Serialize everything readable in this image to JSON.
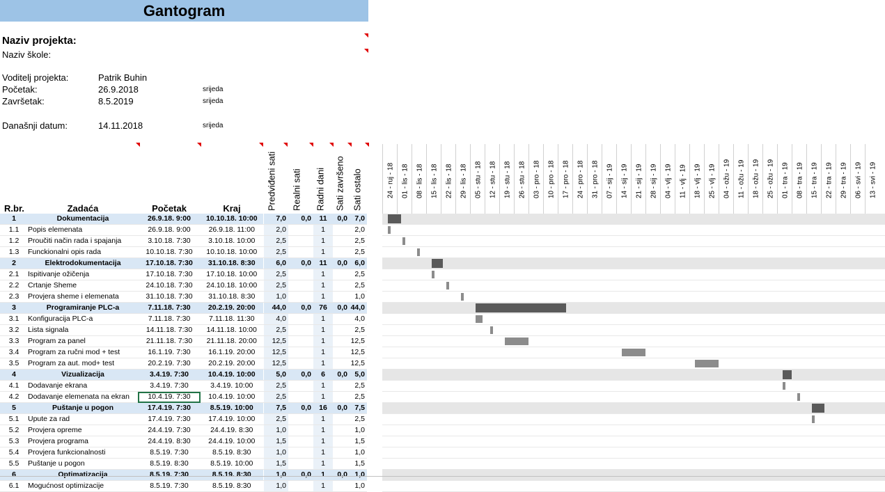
{
  "title": "Gantogram",
  "project": {
    "name_label": "Naziv projekta:",
    "school_label": "Naziv škole:",
    "leader_label": "Voditelj projekta:",
    "leader": "Patrik Buhin",
    "start_label": "Početak:",
    "start_date": "26.9.2018",
    "start_day": "srijeda",
    "end_label": "Završetak:",
    "end_date": "8.5.2019",
    "end_day": "srijeda",
    "today_label": "Današnji datum:",
    "today_date": "14.11.2018",
    "today_day": "srijeda"
  },
  "columns": {
    "id": "R.br.",
    "task": "Zadaća",
    "start": "Početak",
    "end": "Kraj",
    "planned_hours": "Predviđeni sati",
    "real_hours": "Realni sati",
    "work_days": "Radni dani",
    "hours_done": "Sati završeno",
    "hours_left": "Sati ostalo"
  },
  "timeline_weeks": [
    "24 - ruj - 18",
    "01 - lis - 18",
    "08 - lis - 18",
    "15 - lis - 18",
    "22 - lis - 18",
    "29 - lis - 18",
    "05 - stu - 18",
    "12 - stu - 18",
    "19 - stu - 18",
    "26 - stu - 18",
    "03 - pro - 18",
    "10 - pro - 18",
    "17 - pro - 18",
    "24 - pro - 18",
    "31 - pro - 18",
    "07 - sij - 19",
    "14 - sij - 19",
    "21 - sij - 19",
    "28 - sij - 19",
    "04 - vlj - 19",
    "11 - vlj - 19",
    "18 - vlj - 19",
    "25 - vlj - 19",
    "04 - ožu - 19",
    "11 - ožu - 19",
    "18 - ožu - 19",
    "25 - ožu - 19",
    "01 - tra - 19",
    "08 - tra - 19",
    "15 - tra - 19",
    "22 - tra - 19",
    "29 - tra - 19",
    "06 - svi - 19",
    "13 - svi - 19"
  ],
  "rows": [
    {
      "phase": true,
      "id": "1",
      "task": "Dokumentacija",
      "start": "26.9.18. 9:00",
      "end": "10.10.18. 10:00",
      "pred": "7,0",
      "real": "0,0",
      "days": "11",
      "done": "0,0",
      "left": "7,0",
      "bar_start": 0.4,
      "bar_len": 0.9
    },
    {
      "phase": false,
      "id": "1.1",
      "task": "Popis elemenata",
      "start": "26.9.18. 9:00",
      "end": "26.9.18. 11:00",
      "pred": "2,0",
      "real": "",
      "days": "1",
      "done": "",
      "left": "2,0",
      "bar_start": 0.4,
      "bar_len": 0.15
    },
    {
      "phase": false,
      "id": "1.2",
      "task": "Proučiti način rada i spajanja",
      "start": "3.10.18. 7:30",
      "end": "3.10.18. 10:00",
      "pred": "2,5",
      "real": "",
      "days": "1",
      "done": "",
      "left": "2,5",
      "bar_start": 1.4,
      "bar_len": 0.15
    },
    {
      "phase": false,
      "id": "1.3",
      "task": "Funckionalni opis rada",
      "start": "10.10.18. 7:30",
      "end": "10.10.18. 10:00",
      "pred": "2,5",
      "real": "",
      "days": "1",
      "done": "",
      "left": "2,5",
      "bar_start": 2.4,
      "bar_len": 0.15
    },
    {
      "phase": true,
      "id": "2",
      "task": "Elektrodokumentacija",
      "start": "17.10.18. 7:30",
      "end": "31.10.18. 8:30",
      "pred": "6,0",
      "real": "0,0",
      "days": "11",
      "done": "0,0",
      "left": "6,0",
      "bar_start": 3.4,
      "bar_len": 0.75
    },
    {
      "phase": false,
      "id": "2.1",
      "task": "Ispitivanje ožičenja",
      "start": "17.10.18. 7:30",
      "end": "17.10.18. 10:00",
      "pred": "2,5",
      "real": "",
      "days": "1",
      "done": "",
      "left": "2,5",
      "bar_start": 3.4,
      "bar_len": 0.15
    },
    {
      "phase": false,
      "id": "2.2",
      "task": "Crtanje Sheme",
      "start": "24.10.18. 7:30",
      "end": "24.10.18. 10:00",
      "pred": "2,5",
      "real": "",
      "days": "1",
      "done": "",
      "left": "2,5",
      "bar_start": 4.4,
      "bar_len": 0.15
    },
    {
      "phase": false,
      "id": "2.3",
      "task": "Provjera sheme i elemenata",
      "start": "31.10.18. 7:30",
      "end": "31.10.18. 8:30",
      "pred": "1,0",
      "real": "",
      "days": "1",
      "done": "",
      "left": "1,0",
      "bar_start": 5.4,
      "bar_len": 0.15
    },
    {
      "phase": true,
      "id": "3",
      "task": "Programiranje PLC-a",
      "start": "7.11.18. 7:30",
      "end": "20.2.19. 20:00",
      "pred": "44,0",
      "real": "0,0",
      "days": "76",
      "done": "0,0",
      "left": "44,0",
      "bar_start": 6.4,
      "bar_len": 6.15
    },
    {
      "phase": false,
      "id": "3.1",
      "task": "Konfiguracija PLC-a",
      "start": "7.11.18. 7:30",
      "end": "7.11.18. 11:30",
      "pred": "4,0",
      "real": "",
      "days": "1",
      "done": "",
      "left": "4,0",
      "bar_start": 6.4,
      "bar_len": 0.45
    },
    {
      "phase": false,
      "id": "3.2",
      "task": "Lista signala",
      "start": "14.11.18. 7:30",
      "end": "14.11.18. 10:00",
      "pred": "2,5",
      "real": "",
      "days": "1",
      "done": "",
      "left": "2,5",
      "bar_start": 7.4,
      "bar_len": 0.15
    },
    {
      "phase": false,
      "id": "3.3",
      "task": "Program za panel",
      "start": "21.11.18. 7:30",
      "end": "21.11.18. 20:00",
      "pred": "12,5",
      "real": "",
      "days": "1",
      "done": "",
      "left": "12,5",
      "bar_start": 8.4,
      "bar_len": 1.6
    },
    {
      "phase": false,
      "id": "3.4",
      "task": "Program za ručni mod + test",
      "start": "16.1.19. 7:30",
      "end": "16.1.19. 20:00",
      "pred": "12,5",
      "real": "",
      "days": "1",
      "done": "",
      "left": "12,5",
      "bar_start": 16.4,
      "bar_len": 1.6
    },
    {
      "phase": false,
      "id": "3.5",
      "task": "Program za aut. mod+ test",
      "start": "20.2.19. 7:30",
      "end": "20.2.19. 20:00",
      "pred": "12,5",
      "real": "",
      "days": "1",
      "done": "",
      "left": "12,5",
      "bar_start": 21.4,
      "bar_len": 1.6
    },
    {
      "phase": true,
      "id": "4",
      "task": "Vizualizacija",
      "start": "3.4.19. 7:30",
      "end": "10.4.19. 10:00",
      "pred": "5,0",
      "real": "0,0",
      "days": "6",
      "done": "0,0",
      "left": "5,0",
      "bar_start": 27.4,
      "bar_len": 0.6
    },
    {
      "phase": false,
      "id": "4.1",
      "task": "Dodavanje ekrana",
      "start": "3.4.19. 7:30",
      "end": "3.4.19. 10:00",
      "pred": "2,5",
      "real": "",
      "days": "1",
      "done": "",
      "left": "2,5",
      "bar_start": 27.4,
      "bar_len": 0.15
    },
    {
      "phase": false,
      "id": "4.2",
      "task": "Dodavanje elemenata na ekran",
      "start": "10.4.19. 7:30",
      "end": "10.4.19. 10:00",
      "pred": "2,5",
      "real": "",
      "days": "1",
      "done": "",
      "left": "2,5",
      "bar_start": 28.4,
      "bar_len": 0.15,
      "selected": true
    },
    {
      "phase": true,
      "id": "5",
      "task": "Puštanje u pogon",
      "start": "17.4.19. 7:30",
      "end": "8.5.19. 10:00",
      "pred": "7,5",
      "real": "0,0",
      "days": "16",
      "done": "0,0",
      "left": "7,5",
      "bar_start": 29.4,
      "bar_len": 0.85
    },
    {
      "phase": false,
      "id": "5.1",
      "task": "Upute za rad",
      "start": "17.4.19. 7:30",
      "end": "17.4.19. 10:00",
      "pred": "2,5",
      "real": "",
      "days": "1",
      "done": "",
      "left": "2,5",
      "bar_start": 29.4,
      "bar_len": 0.15
    },
    {
      "phase": false,
      "id": "5.2",
      "task": "Provjera opreme",
      "start": "24.4.19. 7:30",
      "end": "24.4.19. 8:30",
      "pred": "1,0",
      "real": "",
      "days": "1",
      "done": "",
      "left": "1,0",
      "bar_start": 30.4,
      "bar_len": 0
    },
    {
      "phase": false,
      "id": "5.3",
      "task": "Provjera programa",
      "start": "24.4.19. 8:30",
      "end": "24.4.19. 10:00",
      "pred": "1,5",
      "real": "",
      "days": "1",
      "done": "",
      "left": "1,5",
      "bar_start": 30.4,
      "bar_len": 0
    },
    {
      "phase": false,
      "id": "5.4",
      "task": "Provjera funkcionalnosti",
      "start": "8.5.19. 7:30",
      "end": "8.5.19. 8:30",
      "pred": "1,0",
      "real": "",
      "days": "1",
      "done": "",
      "left": "1,0",
      "bar_start": 32.4,
      "bar_len": 0
    },
    {
      "phase": false,
      "id": "5.5",
      "task": "Puštanje u pogon",
      "start": "8.5.19. 8:30",
      "end": "8.5.19. 10:00",
      "pred": "1,5",
      "real": "",
      "days": "1",
      "done": "",
      "left": "1,5",
      "bar_start": 32.4,
      "bar_len": 0
    },
    {
      "phase": true,
      "id": "6",
      "task": "Optimatizacija",
      "start": "8.5.19. 7:30",
      "end": "8.5.19. 8:30",
      "pred": "1,0",
      "real": "0,0",
      "days": "1",
      "done": "0,0",
      "left": "1,0",
      "bar_start": 32.4,
      "bar_len": 0
    },
    {
      "phase": false,
      "id": "6.1",
      "task": "Mogućnost optimizacije",
      "start": "8.5.19. 7:30",
      "end": "8.5.19. 8:30",
      "pred": "1,0",
      "real": "",
      "days": "1",
      "done": "",
      "left": "1,0",
      "bar_start": 32.4,
      "bar_len": 0
    }
  ]
}
